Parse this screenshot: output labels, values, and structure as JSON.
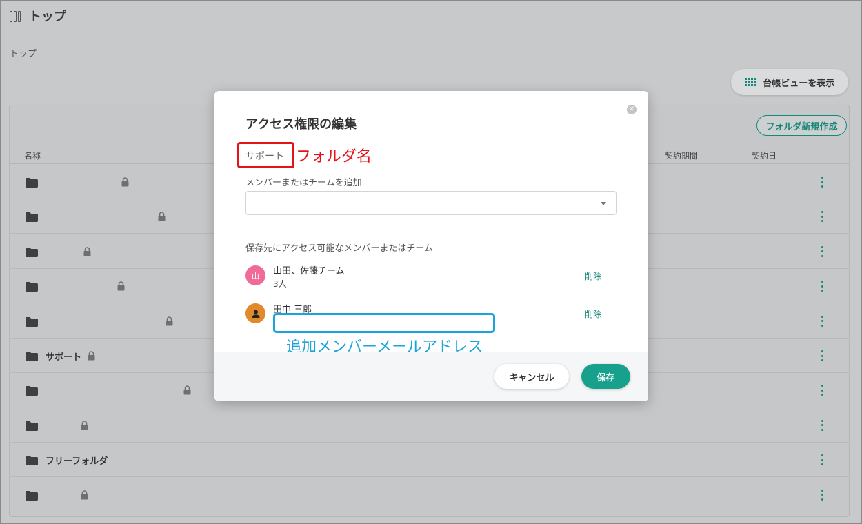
{
  "header": {
    "title": "トップ",
    "logo_icon": "book-shelf-icon"
  },
  "breadcrumb": "トップ",
  "toolbar": {
    "ledger_view_label": "台帳ビューを表示",
    "new_folder_label": "フォルダ新規作成"
  },
  "table": {
    "columns": {
      "name": "名称",
      "contract_period": "契約期間",
      "contract_date": "契約日"
    },
    "rows": [
      {
        "name": "",
        "locked": true
      },
      {
        "name": "",
        "locked": true
      },
      {
        "name": "",
        "locked": true
      },
      {
        "name": "",
        "locked": true
      },
      {
        "name": "",
        "locked": true
      },
      {
        "name": "サポート",
        "locked": true
      },
      {
        "name": "",
        "locked": true
      },
      {
        "name": "",
        "locked": true
      },
      {
        "name": "フリーフォルダ",
        "locked": false
      },
      {
        "name": "",
        "locked": true
      }
    ]
  },
  "modal": {
    "title": "アクセス権限の編集",
    "folder_name": "サポート",
    "add_label": "メンバーまたはチームを追加",
    "add_value": "",
    "access_label": "保存先にアクセス可能なメンバーまたはチーム",
    "members": [
      {
        "avatar_text": "山",
        "avatar_color": "#f06b9a",
        "name": "山田、佐藤チーム",
        "sub": "3人",
        "remove": "削除"
      },
      {
        "avatar_text": "",
        "avatar_color": "#e08a2c",
        "avatar_icon": "person-icon",
        "name": "田中 三郎",
        "sub": "",
        "remove": "削除"
      }
    ],
    "cancel_label": "キャンセル",
    "save_label": "保存"
  },
  "annotations": {
    "folder_name": "フォルダ名",
    "email": "追加メンバーメールアドレス"
  },
  "colors": {
    "accent": "#17877a",
    "save": "#17a08c",
    "annotation_red": "#e6121a",
    "annotation_blue": "#1aa3dc"
  }
}
